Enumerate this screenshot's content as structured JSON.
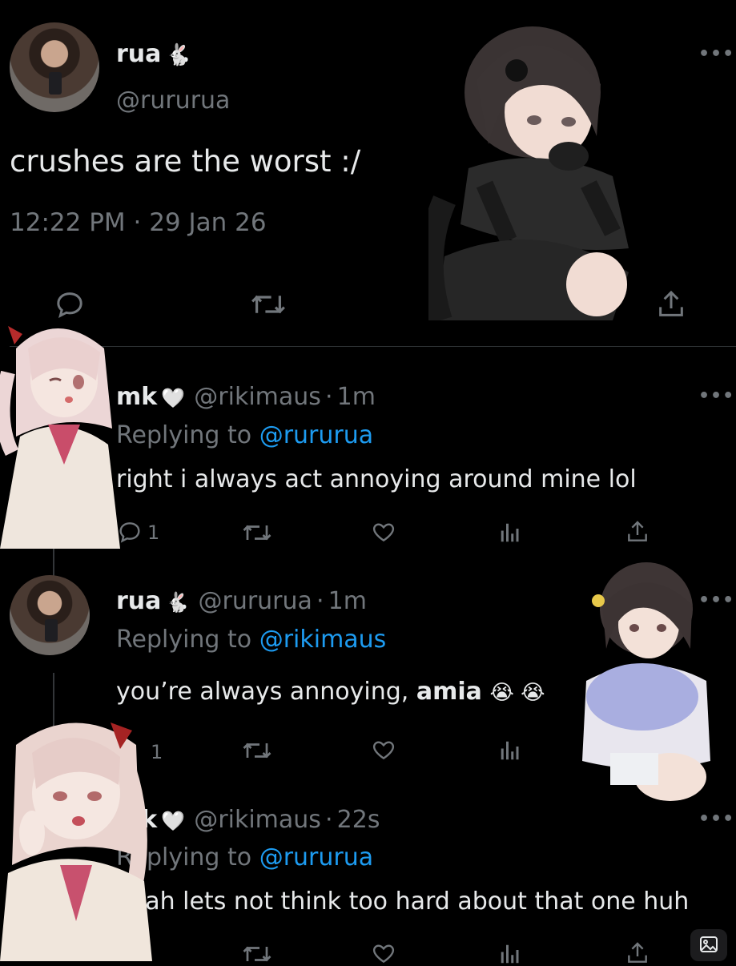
{
  "main_tweet": {
    "author": {
      "name": "rua",
      "emoji": "🐇",
      "handle": "@rururua"
    },
    "more_icon": "more-horizontal-icon",
    "text": "crushes are the worst :/",
    "timestamp": "12:22 PM · 29 Jan 26",
    "actions": [
      "reply-icon",
      "retweet-icon",
      "share-icon"
    ]
  },
  "replies": [
    {
      "author": {
        "name": "mk",
        "emoji": "🤍",
        "handle": "@rikimaus",
        "time": "1m"
      },
      "meta_sep": "·",
      "replying_label": "Replying to",
      "replying_handle": "@rururua",
      "text": "right i always act annoying around mine lol",
      "reply_count": "1"
    },
    {
      "author": {
        "name": "rua",
        "emoji": "🐇",
        "handle": "@rururua",
        "time": "1m"
      },
      "meta_sep": "·",
      "replying_label": "Replying to",
      "replying_handle": "@rikimaus",
      "text_prefix": "you’re always annoying,",
      "text_bold": "amia",
      "text_emojis": "😭 😭",
      "reply_count": "1"
    },
    {
      "author": {
        "name": "mk",
        "emoji": "🤍",
        "handle": "@rikimaus",
        "time": "22s"
      },
      "meta_sep": "·",
      "replying_label": "Replying to",
      "replying_handle": "@rururua",
      "text": "yeah lets not think too hard about that one huh"
    }
  ],
  "colors": {
    "background": "#000000",
    "text": "#e7e9ea",
    "muted": "#71767b",
    "link": "#1d9bf0",
    "divider": "#2f3336"
  },
  "stickers": [
    "anime-girl-dark-hair-sitting",
    "anime-girl-pink-hair-winking",
    "anime-girl-dark-hair-pillow",
    "anime-girl-pink-hair-crying"
  ]
}
